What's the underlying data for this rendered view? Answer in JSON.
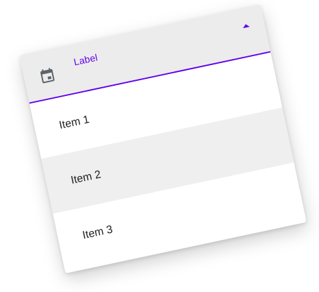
{
  "select": {
    "label": "Label",
    "leading_icon": "calendar-icon",
    "trailing_icon": "arrow-drop-up-icon",
    "accent_color": "#6200ee"
  },
  "menu": {
    "items": [
      {
        "label": "Item 1",
        "selected": false
      },
      {
        "label": "Item 2",
        "selected": true
      },
      {
        "label": "Item 3",
        "selected": false
      }
    ]
  }
}
